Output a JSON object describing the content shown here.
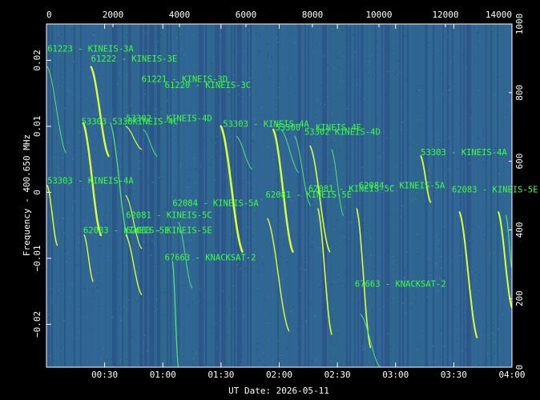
{
  "chart_data": {
    "type": "heatmap",
    "title": "",
    "xlabel": "UT Date: 2026-05-11",
    "ylabel": "Frequency - 400.650 MHz",
    "x_ticks": [
      "00:30",
      "01:00",
      "01:30",
      "02:00",
      "02:30",
      "03:00",
      "03:30",
      "04:00"
    ],
    "x_tick_minutes": [
      30,
      60,
      90,
      120,
      150,
      180,
      210,
      240
    ],
    "xlim_minutes": [
      0,
      240
    ],
    "y_ticks": [
      "0.02",
      "0.01",
      "0",
      "−0.01",
      "−0.02"
    ],
    "y_tick_values": [
      0.02,
      0.01,
      0,
      -0.01,
      -0.02
    ],
    "ylim": [
      -0.0265,
      0.0255
    ],
    "top_axis_ticks": [
      "0",
      "2000",
      "4000",
      "6000",
      "8000",
      "10000",
      "12000",
      "14000"
    ],
    "top_axis_values": [
      0,
      2000,
      4000,
      6000,
      8000,
      10000,
      12000,
      14000
    ],
    "top_axis_range": [
      0,
      14000
    ],
    "right_axis_ticks": [
      "0",
      "200",
      "400",
      "600",
      "800",
      "1000"
    ],
    "right_axis_values": [
      0,
      200,
      400,
      600,
      800,
      1000
    ],
    "right_axis_range": [
      0,
      1000
    ],
    "colors": {
      "background": "#2f5f8e",
      "trace": "#d8ff3a",
      "faint_trace": "#54e07a",
      "label": "#3cff3c",
      "axis": "#ffffff"
    },
    "traces": [
      {
        "t0": 0.5,
        "t1": 10,
        "f0": 0.019,
        "f1": 0.006,
        "w": 1.0,
        "c": "faint"
      },
      {
        "t0": 0.5,
        "t1": 5.5,
        "f0": 0.001,
        "f1": -0.008,
        "w": 1.5,
        "c": "bright"
      },
      {
        "t0": 19,
        "t1": 28,
        "f0": 0.0105,
        "f1": -0.0065,
        "w": 2.4,
        "c": "bright"
      },
      {
        "t0": 19.5,
        "t1": 24,
        "f0": -0.0065,
        "f1": -0.0135,
        "w": 1.4,
        "c": "bright"
      },
      {
        "t0": 23,
        "t1": 32,
        "f0": 0.019,
        "f1": 0.0055,
        "w": 2.4,
        "c": "bright"
      },
      {
        "t0": 33,
        "t1": 42,
        "f0": 0.0105,
        "f1": -0.007,
        "w": 1.3,
        "c": "faint"
      },
      {
        "t0": 41,
        "t1": 49,
        "f0": 0.01,
        "f1": 0.0065,
        "w": 1.2,
        "c": "bright"
      },
      {
        "t0": 41,
        "t1": 49,
        "f0": -0.0005,
        "f1": -0.0085,
        "w": 1.2,
        "c": "bright"
      },
      {
        "t0": 41,
        "t1": 49,
        "f0": -0.0065,
        "f1": -0.0155,
        "w": 1.4,
        "c": "bright"
      },
      {
        "t0": 50,
        "t1": 57,
        "f0": 0.0095,
        "f1": 0.0055,
        "w": 1.0,
        "c": "faint"
      },
      {
        "t0": 65,
        "t1": 68,
        "f0": -0.0105,
        "f1": -0.0265,
        "w": 1.3,
        "c": "faint"
      },
      {
        "t0": 68,
        "t1": 75,
        "f0": -0.0045,
        "f1": -0.0145,
        "w": 1.0,
        "c": "faint"
      },
      {
        "t0": 90,
        "t1": 101,
        "f0": 0.01,
        "f1": -0.009,
        "w": 2.6,
        "c": "bright"
      },
      {
        "t0": 98,
        "t1": 106,
        "f0": 0.0085,
        "f1": 0.0035,
        "w": 1.0,
        "c": "faint"
      },
      {
        "t0": 114,
        "t1": 125,
        "f0": -0.004,
        "f1": -0.021,
        "w": 1.4,
        "c": "bright"
      },
      {
        "t0": 117,
        "t1": 127,
        "f0": 0.0095,
        "f1": -0.009,
        "w": 2.4,
        "c": "bright"
      },
      {
        "t0": 121,
        "t1": 130,
        "f0": 0.0095,
        "f1": 0.003,
        "w": 1.0,
        "c": "faint"
      },
      {
        "t0": 128,
        "t1": 136,
        "f0": 0.0085,
        "f1": -0.002,
        "w": 1.0,
        "c": "faint"
      },
      {
        "t0": 136,
        "t1": 146,
        "f0": 0.007,
        "f1": -0.009,
        "w": 1.6,
        "c": "bright"
      },
      {
        "t0": 140,
        "t1": 147,
        "f0": -0.0025,
        "f1": -0.0215,
        "w": 1.6,
        "c": "bright"
      },
      {
        "t0": 147,
        "t1": 153,
        "f0": 0.0065,
        "f1": -0.0035,
        "w": 1.0,
        "c": "faint"
      },
      {
        "t0": 160,
        "t1": 167,
        "f0": -0.0025,
        "f1": -0.0235,
        "w": 1.6,
        "c": "bright"
      },
      {
        "t0": 162,
        "t1": 172,
        "f0": -0.0185,
        "f1": -0.0265,
        "w": 1.0,
        "c": "faint"
      },
      {
        "t0": 193,
        "t1": 198,
        "f0": 0.0055,
        "f1": -0.0015,
        "w": 1.8,
        "c": "bright"
      },
      {
        "t0": 213,
        "t1": 222,
        "f0": -0.003,
        "f1": -0.022,
        "w": 2.0,
        "c": "bright"
      },
      {
        "t0": 233,
        "t1": 240,
        "f0": -0.003,
        "f1": -0.0175,
        "w": 2.0,
        "c": "bright"
      },
      {
        "t0": 237,
        "t1": 240,
        "f0": -0.0035,
        "f1": -0.0115,
        "w": 1.2,
        "c": "faint"
      }
    ],
    "annotations": [
      {
        "text": "61223 - KINEIS-3A",
        "t": 0.5,
        "f": 0.0213
      },
      {
        "text": "61222 - KINEIS-3E",
        "t": 23,
        "f": 0.0198
      },
      {
        "text": "61221 - KINEIS-3D",
        "t": 49,
        "f": 0.0167
      },
      {
        "text": "61220 - KINEIS-3C",
        "t": 61,
        "f": 0.0158
      },
      {
        "text": "53303",
        "t": 18,
        "f": 0.0103
      },
      {
        "text": "5338KINEIS-4C",
        "t": 34,
        "f": 0.0103
      },
      {
        "text": "53302 - KINEIS-4D",
        "t": 41,
        "f": 0.0108
      },
      {
        "text": "53303 - KINEIS-4A",
        "t": 91,
        "f": 0.0099
      },
      {
        "text": "53300 - KINEIS-4E",
        "t": 118,
        "f": 0.0094
      },
      {
        "text": "53302 KINEIS-4D",
        "t": 133,
        "f": 0.0087
      },
      {
        "text": "53303 - KINEIS-4A",
        "t": 193,
        "f": 0.0056
      },
      {
        "text": "53303 - KINEIS-4A",
        "t": 0.5,
        "f": 0.0013
      },
      {
        "text": "62084 - KINEIS-5A",
        "t": 65,
        "f": -0.0021
      },
      {
        "text": "62081 - KINEIS-5C",
        "t": 41,
        "f": -0.0039
      },
      {
        "text": "62083 - KINEIS-5E",
        "t": 19,
        "f": -0.0062
      },
      {
        "text": "62083 - KINEIS-5E",
        "t": 41,
        "f": -0.0062
      },
      {
        "text": "62081 - KINEIS-5E",
        "t": 113,
        "f": -0.0008
      },
      {
        "text": "62081 - KINEIS-5C",
        "t": 135,
        "f": 0.0001
      },
      {
        "text": "62084 - KINEIS-5A",
        "t": 161,
        "f": 0.0006
      },
      {
        "text": "62083 - KINEIS-5E",
        "t": 209,
        "f": -0.0
      },
      {
        "text": "67663 - KNACKSAT-2",
        "t": 61,
        "f": -0.0103
      },
      {
        "text": "67663 - KNACKSAT-2",
        "t": 159,
        "f": -0.0143
      }
    ]
  }
}
